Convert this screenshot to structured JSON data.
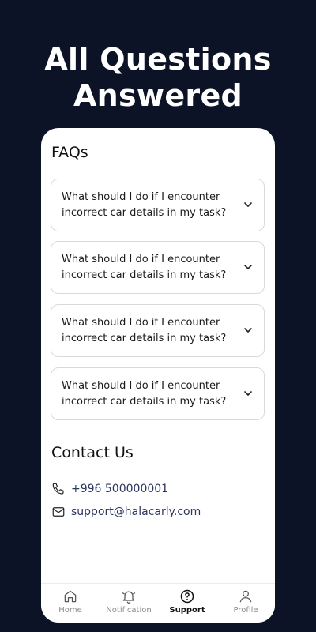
{
  "hero": {
    "title_line1": "All Questions",
    "title_line2": "Answered"
  },
  "faq": {
    "title": "FAQs",
    "items": [
      {
        "question": "What should I do if I encounter incorrect car details in my task?"
      },
      {
        "question": "What should I do if I encounter incorrect car details in my task?"
      },
      {
        "question": "What should I do if I encounter incorrect car details in my task?"
      },
      {
        "question": "What should I do if I encounter incorrect car details in my task?"
      }
    ]
  },
  "contact": {
    "title": "Contact Us",
    "phone": "+996 500000001",
    "email": "support@halacarly.com"
  },
  "tabs": [
    {
      "label": "Home",
      "icon": "home-icon"
    },
    {
      "label": "Notification",
      "icon": "bell-icon"
    },
    {
      "label": "Support",
      "icon": "help-circle-icon",
      "active": true
    },
    {
      "label": "Profile",
      "icon": "user-icon"
    }
  ],
  "colors": {
    "background": "#0d1326",
    "card": "#ffffff",
    "contact_text": "#2d3561"
  }
}
